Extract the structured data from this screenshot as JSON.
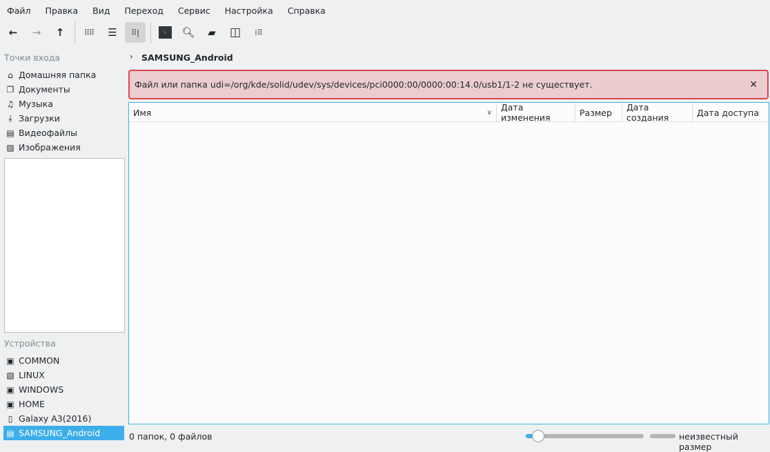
{
  "menu": [
    "Файл",
    "Правка",
    "Вид",
    "Переход",
    "Сервис",
    "Настройка",
    "Справка"
  ],
  "places": {
    "title": "Точки входа",
    "items": [
      {
        "label": "Домашняя папка",
        "icon": "home-icon"
      },
      {
        "label": "Документы",
        "icon": "documents-icon"
      },
      {
        "label": "Музыка",
        "icon": "music-icon"
      },
      {
        "label": "Загрузки",
        "icon": "downloads-icon"
      },
      {
        "label": "Видеофайлы",
        "icon": "video-icon"
      },
      {
        "label": "Изображения",
        "icon": "images-icon"
      }
    ]
  },
  "devices": {
    "title": "Устройства",
    "items": [
      {
        "label": "COMMON"
      },
      {
        "label": "LINUX"
      },
      {
        "label": "WINDOWS"
      },
      {
        "label": "HOME"
      },
      {
        "label": "Galaxy A3(2016)"
      },
      {
        "label": "SAMSUNG_Android",
        "selected": true
      }
    ]
  },
  "breadcrumb": "SAMSUNG_Android",
  "error": "Файл или папка udi=/org/kde/solid/udev/sys/devices/pci0000:00/0000:00:14.0/usb1/1-2 не существует.",
  "columns": [
    "Имя",
    "Дата изменения",
    "Размер",
    "Дата создания",
    "Дата доступа"
  ],
  "status": {
    "text": "0 папок, 0 файлов",
    "zoom_percent": 5,
    "free_space": "неизвестный размер"
  },
  "colors": {
    "accent": "#3daee9",
    "error": "#da4453"
  }
}
